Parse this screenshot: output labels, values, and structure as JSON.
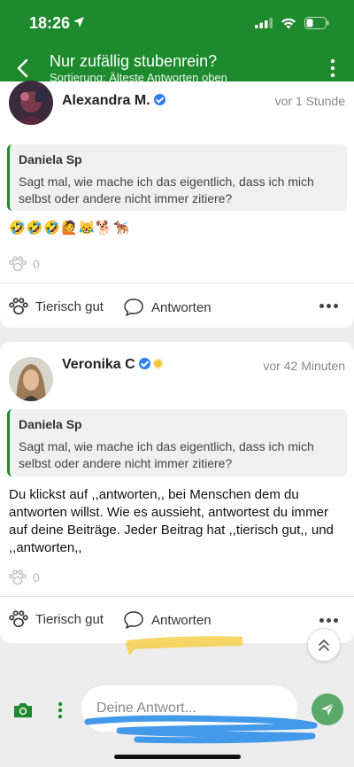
{
  "status_bar": {
    "time": "18:26"
  },
  "nav": {
    "title": "Nur zufällig stubenrein?",
    "subtitle": "Sortierung: Älteste Antworten oben"
  },
  "posts": [
    {
      "author": "Alexandra M.",
      "time_ago": "vor 1 Stunde",
      "quote_author": "Daniela Sp",
      "quote_text": "Sagt mal, wie mache ich das eigentlich, dass ich mich selbst oder andere nicht immer zitiere?",
      "body": "🤣🤣🤣🙋😹🐕🐕‍🦺",
      "likes": "0",
      "like_label": "Tierisch gut",
      "reply_label": "Antworten"
    },
    {
      "author": "Veronika C",
      "time_ago": "vor 42 Minuten",
      "quote_author": "Daniela Sp",
      "quote_text": "Sagt mal, wie mache ich das eigentlich, dass ich mich selbst oder andere nicht immer zitiere?",
      "body": "Du klickst auf ,,antworten,, bei Menschen dem du antworten willst. Wie es aussieht, antwortest du immer auf deine Beiträge. Jeder Beitrag hat ,,tierisch gut,, und ,,antworten,,",
      "likes": "0",
      "like_label": "Tierisch gut",
      "reply_label": "Antworten"
    }
  ],
  "composer": {
    "placeholder": "Deine Antwort..."
  },
  "colors": {
    "brand": "#1e8a2e",
    "send": "#5aa96a",
    "verified": "#2d7ff0"
  },
  "icons": [
    "location-arrow-icon",
    "signal-icon",
    "wifi-icon",
    "battery-icon",
    "back-icon",
    "more-vertical-icon",
    "paw-icon",
    "comment-icon",
    "more-horizontal-icon",
    "chevrons-up-icon",
    "camera-icon",
    "send-icon"
  ]
}
